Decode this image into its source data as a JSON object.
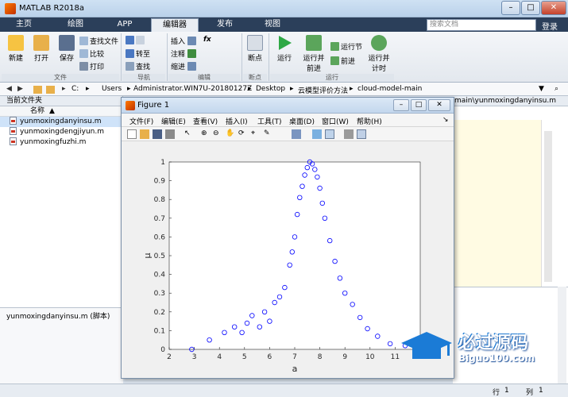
{
  "window": {
    "title": "MATLAB R2018a",
    "minimize": "–",
    "maximize": "□",
    "close": "✕"
  },
  "tabs": [
    {
      "label": "主页"
    },
    {
      "label": "绘图"
    },
    {
      "label": "APP"
    },
    {
      "label": "编辑器",
      "active": true
    },
    {
      "label": "发布"
    },
    {
      "label": "视图"
    }
  ],
  "search": {
    "placeholder": "搜索文档",
    "login": "登录"
  },
  "ribbon": {
    "file": {
      "new": "新建",
      "open": "打开",
      "save": "保存",
      "find_files": "查找文件",
      "compare": "比较",
      "print": "打印",
      "group": "文件"
    },
    "nav": {
      "goto": "转至",
      "find": "查找",
      "group": "导航"
    },
    "edit": {
      "insert": "插入",
      "comment": "注释",
      "indent": "缩进",
      "fx": "fx",
      "group": "编辑"
    },
    "breakpoints": {
      "label": "断点",
      "group": "断点"
    },
    "run": {
      "run": "运行",
      "run_advance": "运行并前进",
      "run_section": "运行节",
      "advance": "前进",
      "run_time": "运行并计时",
      "group": "运行"
    }
  },
  "address": {
    "parts": [
      "C:",
      "Users",
      "Administrator.WIN7U-20180127Z",
      "Desktop",
      "云模型评价方法",
      "cloud-model-main"
    ],
    "right_fragment": "main\\yunmoxingdanyinsu.m"
  },
  "file_panel": {
    "title": "当前文件夹",
    "column": "名称",
    "files": [
      {
        "name": "yunmoxingdanyinsu.m",
        "selected": true
      },
      {
        "name": "yunmoxingdengjiyun.m",
        "selected": false
      },
      {
        "name": "yunmoxingfuzhi.m",
        "selected": false
      }
    ],
    "detail": "yunmoxingdanyinsu.m  (脚本)"
  },
  "status": {
    "row_label": "行",
    "row": "1",
    "col_label": "列",
    "col": "1"
  },
  "figure": {
    "title": "Figure 1",
    "menus": [
      "文件(F)",
      "编辑(E)",
      "查看(V)",
      "插入(I)",
      "工具(T)",
      "桌面(D)",
      "窗口(W)",
      "帮助(H)"
    ]
  },
  "chart_data": {
    "type": "scatter",
    "title": "",
    "xlabel": "a",
    "ylabel": "μ",
    "xlim": [
      2,
      12
    ],
    "ylim": [
      0,
      1
    ],
    "xticks": [
      2,
      3,
      4,
      5,
      6,
      7,
      8,
      9,
      10,
      11,
      12
    ],
    "yticks": [
      0,
      0.1,
      0.2,
      0.3,
      0.4,
      0.5,
      0.6,
      0.7,
      0.8,
      0.9,
      1
    ],
    "marker": "circle",
    "color": "#0000ff",
    "grid": false,
    "points": [
      [
        2.9,
        0.0
      ],
      [
        3.6,
        0.05
      ],
      [
        4.2,
        0.09
      ],
      [
        4.6,
        0.12
      ],
      [
        4.9,
        0.09
      ],
      [
        5.1,
        0.14
      ],
      [
        5.3,
        0.18
      ],
      [
        5.6,
        0.12
      ],
      [
        5.8,
        0.2
      ],
      [
        6.0,
        0.15
      ],
      [
        6.2,
        0.25
      ],
      [
        6.4,
        0.28
      ],
      [
        6.6,
        0.33
      ],
      [
        6.8,
        0.45
      ],
      [
        6.9,
        0.52
      ],
      [
        7.0,
        0.6
      ],
      [
        7.1,
        0.72
      ],
      [
        7.2,
        0.81
      ],
      [
        7.3,
        0.87
      ],
      [
        7.4,
        0.93
      ],
      [
        7.5,
        0.97
      ],
      [
        7.6,
        1.0
      ],
      [
        7.7,
        0.99
      ],
      [
        7.8,
        0.96
      ],
      [
        7.9,
        0.92
      ],
      [
        8.0,
        0.86
      ],
      [
        8.1,
        0.78
      ],
      [
        8.2,
        0.7
      ],
      [
        8.4,
        0.58
      ],
      [
        8.6,
        0.47
      ],
      [
        8.8,
        0.38
      ],
      [
        9.0,
        0.3
      ],
      [
        9.3,
        0.24
      ],
      [
        9.6,
        0.17
      ],
      [
        9.9,
        0.11
      ],
      [
        10.3,
        0.07
      ],
      [
        10.8,
        0.03
      ],
      [
        11.4,
        0.02
      ],
      [
        12.0,
        0.01
      ]
    ]
  },
  "watermark": {
    "text": "必过源码",
    "url": "Biguo100.com"
  }
}
